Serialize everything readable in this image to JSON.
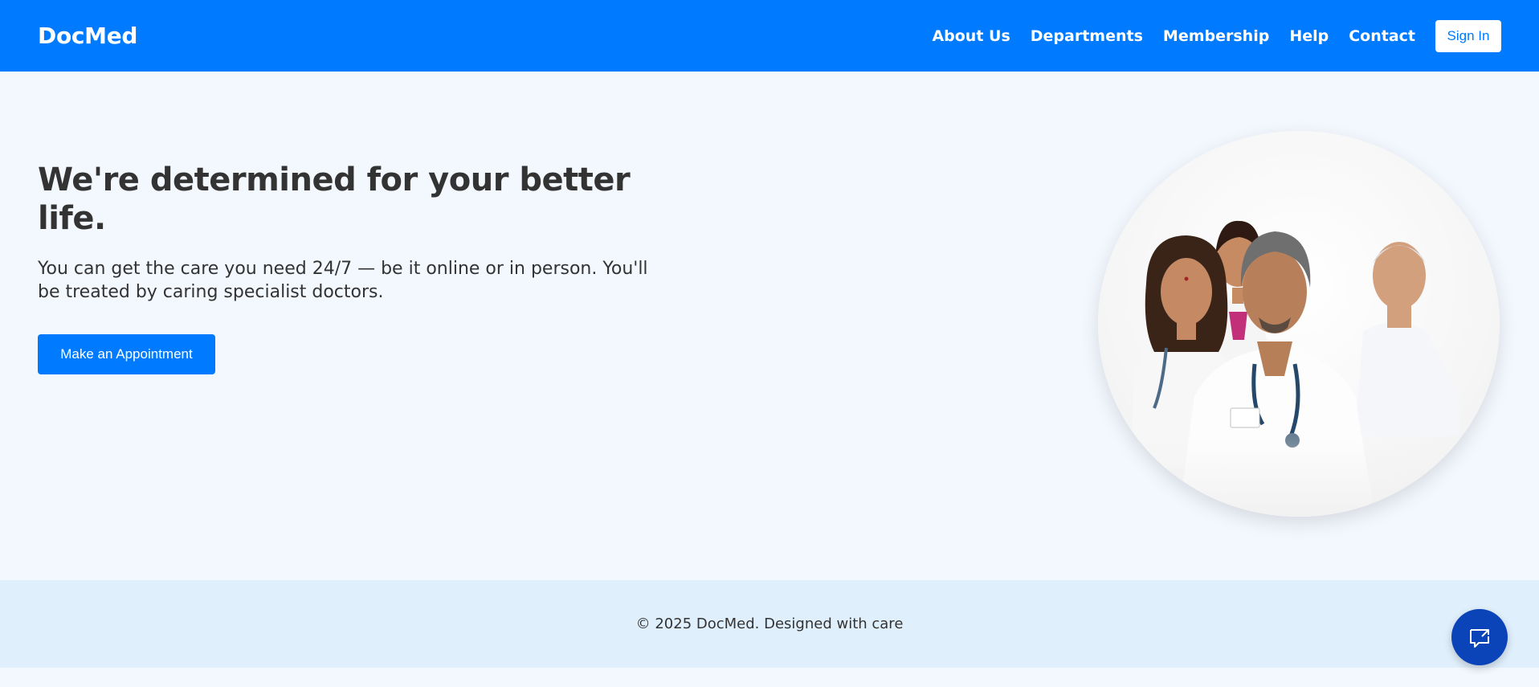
{
  "brand": {
    "name": "DocMed"
  },
  "nav": {
    "links": [
      "About Us",
      "Departments",
      "Membership",
      "Help",
      "Contact"
    ],
    "sign_in": "Sign In"
  },
  "hero": {
    "title": "We're determined for your better life.",
    "subtitle": "You can get the care you need 24/7 — be it online or in person. You'll be treated by caring specialist doctors.",
    "cta": "Make an Appointment",
    "image_alt": "doctors-team-photo"
  },
  "footer": {
    "copyright": "© 2025 DocMed. Designed with care"
  },
  "chat": {
    "icon": "chat-bubble-icon"
  },
  "colors": {
    "primary": "#007bff",
    "page_background": "#f3f8fe",
    "footer_background": "#e0effc",
    "chat_button": "#0a44b8",
    "text": "#333333"
  }
}
